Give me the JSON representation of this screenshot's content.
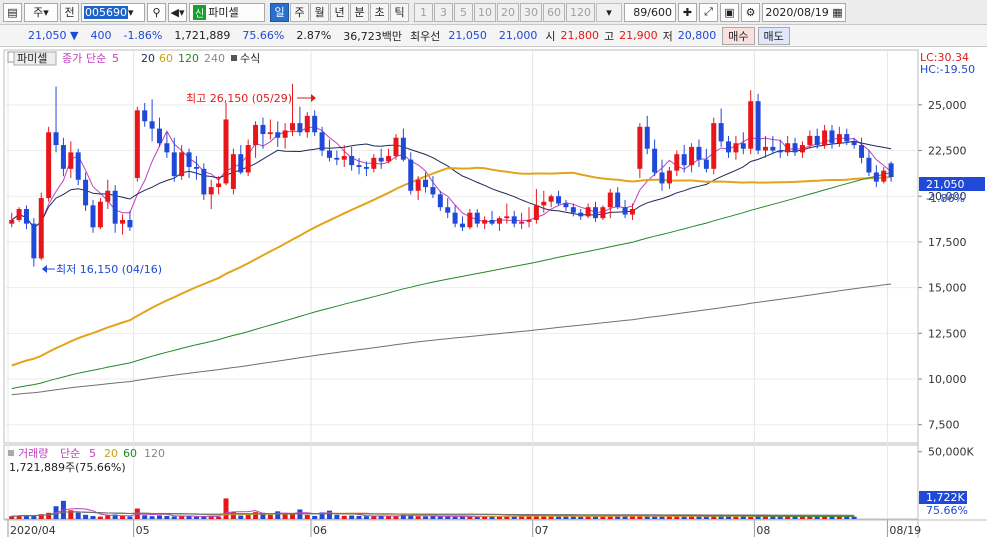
{
  "toolbar": {
    "period_btn": "주",
    "prev_btn": "전",
    "stock_code": "005690",
    "credit_badge": "신",
    "stock_name": "파미셀",
    "periods": [
      "일",
      "주",
      "월",
      "년",
      "분",
      "초",
      "틱"
    ],
    "active_period": "일",
    "intervals": [
      "1",
      "3",
      "5",
      "10",
      "20",
      "30",
      "60",
      "120"
    ],
    "count": "89/600",
    "date": "2020/08/19"
  },
  "quote": {
    "price": "21,050",
    "change": "400",
    "change_pct": "-1.86%",
    "volume": "1,721,889",
    "vol_ratio": "75.66%",
    "turnover": "2.87%",
    "amount": "36,723백만",
    "bid_label": "최우선",
    "bid": "21,050",
    "ask": "21,000",
    "open_label": "시",
    "open": "21,800",
    "high_label": "고",
    "high": "21,900",
    "low_label": "저",
    "low": "20,800",
    "buy_btn": "매수",
    "sell_btn": "매도"
  },
  "price_panel": {
    "name_tag": "파미셀",
    "legend_close": "종가",
    "legend_method": "단순",
    "ma_periods": [
      "5",
      "20",
      "60",
      "120",
      "240"
    ],
    "formula": "수식",
    "lc_label": "LC:30.34",
    "hc_label": "HC:-19.50",
    "high_annotation": "최고 26,150 (05/29)",
    "low_annotation": "최저 16,150 (04/16)",
    "last_price_tag": "21,050",
    "last_pct_tag": "-1.86%"
  },
  "volume_panel": {
    "title": "거래량",
    "method": "단순",
    "ma_periods": [
      "5",
      "20",
      "60",
      "120"
    ],
    "info": "1,721,889주(75.66%)",
    "last_tag": "1,722K",
    "pct_tag": "75.66%"
  },
  "colors": {
    "up": "#e8161b",
    "down": "#1f49d6",
    "ma5": "#c040c0",
    "ma20": "#1c2a5a",
    "ma60": "#e3a41c",
    "ma120": "#24882a",
    "ma240": "#707070"
  },
  "chart_data": {
    "type": "candlestick",
    "y_ticks": [
      7500,
      10000,
      12500,
      15000,
      17500,
      20000,
      22500,
      25000
    ],
    "y_tick_labels": [
      "7,500",
      "10,000",
      "12,500",
      "15,000",
      "17,500",
      "20,000",
      "22,500",
      "25,000"
    ],
    "ylim": [
      6500,
      28000
    ],
    "volume_tick_labels": [
      "50,000K"
    ],
    "volume_ylim": [
      0,
      55000
    ],
    "x_labels": [
      "2020/04",
      "05",
      "06",
      "07",
      "08",
      "08/19"
    ],
    "x_label_index": [
      0,
      17,
      41,
      71,
      101,
      119
    ],
    "candles": [
      [
        18500,
        19100,
        18300,
        18700
      ],
      [
        18700,
        19400,
        18600,
        19300
      ],
      [
        19300,
        19500,
        18200,
        18500
      ],
      [
        18500,
        18800,
        16150,
        16600
      ],
      [
        16600,
        20200,
        16500,
        19900
      ],
      [
        19900,
        23800,
        19700,
        23500
      ],
      [
        23500,
        26000,
        22400,
        22800
      ],
      [
        22800,
        23200,
        21100,
        21500
      ],
      [
        21500,
        23000,
        21000,
        22400
      ],
      [
        22400,
        22600,
        20600,
        20900
      ],
      [
        20900,
        21300,
        19200,
        19500
      ],
      [
        19500,
        19800,
        18000,
        18300
      ],
      [
        18300,
        19900,
        18200,
        19700
      ],
      [
        19700,
        20900,
        19300,
        20300
      ],
      [
        20300,
        20600,
        18000,
        18500
      ],
      [
        18500,
        19000,
        17900,
        18700
      ],
      [
        18700,
        19200,
        18100,
        18300
      ],
      [
        21000,
        24900,
        20800,
        24700
      ],
      [
        24700,
        25100,
        23800,
        24100
      ],
      [
        24100,
        25300,
        23000,
        23700
      ],
      [
        23700,
        24300,
        22700,
        22900
      ],
      [
        22900,
        23500,
        22100,
        22400
      ],
      [
        22400,
        23200,
        20800,
        21100
      ],
      [
        21100,
        22800,
        20900,
        22400
      ],
      [
        22400,
        22600,
        21000,
        21600
      ],
      [
        21600,
        22200,
        20900,
        21500
      ],
      [
        21500,
        21800,
        19800,
        20100
      ],
      [
        20100,
        20900,
        19300,
        20500
      ],
      [
        20500,
        21100,
        20100,
        20700
      ],
      [
        20700,
        25100,
        20600,
        24200
      ],
      [
        20400,
        22600,
        20100,
        22300
      ],
      [
        22300,
        22800,
        21200,
        21300
      ],
      [
        21300,
        23100,
        21100,
        22800
      ],
      [
        22800,
        24100,
        22100,
        23900
      ],
      [
        23900,
        24300,
        22600,
        23400
      ],
      [
        23400,
        24200,
        23100,
        23500
      ],
      [
        23500,
        24100,
        22700,
        23200
      ],
      [
        23200,
        24000,
        22600,
        23600
      ],
      [
        23600,
        26150,
        23300,
        24000
      ],
      [
        24000,
        24900,
        23300,
        23500
      ],
      [
        23500,
        24600,
        23200,
        24400
      ],
      [
        24400,
        24700,
        23300,
        23500
      ],
      [
        23500,
        23800,
        22200,
        22500
      ],
      [
        22500,
        23100,
        21900,
        22100
      ],
      [
        22100,
        22500,
        21700,
        22000
      ],
      [
        22000,
        22800,
        21600,
        22200
      ],
      [
        22200,
        22700,
        21400,
        21700
      ],
      [
        21700,
        22100,
        21200,
        21600
      ],
      [
        21600,
        21900,
        21100,
        21500
      ],
      [
        21500,
        22300,
        21300,
        22100
      ],
      [
        22100,
        22600,
        21500,
        21900
      ],
      [
        21900,
        22600,
        21800,
        22200
      ],
      [
        22200,
        23400,
        22000,
        23200
      ],
      [
        23200,
        23700,
        21900,
        22000
      ],
      [
        22000,
        22400,
        20100,
        20300
      ],
      [
        20300,
        21100,
        19800,
        20900
      ],
      [
        20900,
        21300,
        20200,
        20500
      ],
      [
        20500,
        21100,
        19900,
        20100
      ],
      [
        20100,
        20300,
        19200,
        19400
      ],
      [
        19400,
        19900,
        18800,
        19100
      ],
      [
        19100,
        19500,
        18300,
        18500
      ],
      [
        18500,
        18900,
        18100,
        18300
      ],
      [
        18300,
        19300,
        18200,
        19100
      ],
      [
        19100,
        19300,
        18300,
        18500
      ],
      [
        18500,
        18900,
        18200,
        18700
      ],
      [
        18700,
        19200,
        18400,
        18500
      ],
      [
        18500,
        18900,
        18100,
        18800
      ],
      [
        18800,
        19600,
        18500,
        18900
      ],
      [
        18900,
        19200,
        18300,
        18500
      ],
      [
        18500,
        19100,
        18200,
        18600
      ],
      [
        18600,
        19400,
        18300,
        18700
      ],
      [
        18700,
        20400,
        18500,
        19500
      ],
      [
        19500,
        20300,
        19100,
        19700
      ],
      [
        19700,
        20100,
        19400,
        20000
      ],
      [
        20000,
        20300,
        19500,
        19600
      ],
      [
        19600,
        19800,
        19200,
        19400
      ],
      [
        19400,
        19600,
        18900,
        19100
      ],
      [
        19100,
        19300,
        18700,
        18900
      ],
      [
        18900,
        19600,
        18800,
        19400
      ],
      [
        19400,
        19700,
        18600,
        18800
      ],
      [
        18800,
        19500,
        18700,
        19400
      ],
      [
        19400,
        20400,
        18800,
        20200
      ],
      [
        20200,
        20500,
        19300,
        19400
      ],
      [
        19400,
        19800,
        18800,
        19000
      ],
      [
        19000,
        19600,
        18700,
        19300
      ],
      [
        21500,
        24000,
        21000,
        23800
      ],
      [
        23800,
        24400,
        22300,
        22600
      ],
      [
        22600,
        23100,
        21100,
        21300
      ],
      [
        21300,
        22000,
        20300,
        20700
      ],
      [
        20700,
        21600,
        20400,
        21400
      ],
      [
        21400,
        22500,
        21100,
        22300
      ],
      [
        22300,
        22800,
        21300,
        21700
      ],
      [
        21700,
        22900,
        21300,
        22700
      ],
      [
        22700,
        23100,
        21600,
        22000
      ],
      [
        22000,
        22600,
        21300,
        21500
      ],
      [
        21500,
        24300,
        21200,
        24000
      ],
      [
        24000,
        24800,
        22700,
        23000
      ],
      [
        23000,
        23300,
        22100,
        22400
      ],
      [
        22400,
        23300,
        22000,
        22900
      ],
      [
        22900,
        23500,
        22300,
        22600
      ],
      [
        22600,
        25800,
        22300,
        25200
      ],
      [
        25200,
        25600,
        22300,
        22500
      ],
      [
        22500,
        23300,
        22100,
        22700
      ],
      [
        22700,
        23300,
        22300,
        22500
      ],
      [
        22500,
        23100,
        22100,
        22400
      ],
      [
        22400,
        23300,
        22200,
        22900
      ],
      [
        22900,
        23200,
        22200,
        22400
      ],
      [
        22400,
        23000,
        22100,
        22800
      ],
      [
        22800,
        23600,
        22600,
        23300
      ],
      [
        23300,
        23700,
        22600,
        22800
      ],
      [
        22800,
        23900,
        22600,
        23600
      ],
      [
        23600,
        23900,
        22600,
        22900
      ],
      [
        22900,
        23800,
        22700,
        23400
      ],
      [
        23400,
        23700,
        22800,
        23000
      ],
      [
        23000,
        23200,
        22600,
        22800
      ],
      [
        22800,
        23200,
        21800,
        22100
      ],
      [
        22100,
        22500,
        21100,
        21300
      ],
      [
        21300,
        21700,
        20500,
        20800
      ],
      [
        20800,
        21600,
        20700,
        21400
      ],
      [
        21800,
        21900,
        20800,
        21050
      ]
    ],
    "volume_k": [
      2100,
      2500,
      3000,
      2400,
      3600,
      4600,
      9500,
      13500,
      6500,
      4700,
      3100,
      2200,
      1800,
      2700,
      3300,
      2300,
      1900,
      7800,
      2800,
      2100,
      2700,
      2300,
      1900,
      2100,
      2000,
      1700,
      2100,
      1900,
      1600,
      15300,
      5300,
      2500,
      2900,
      5100,
      4600,
      3100,
      5700,
      3400,
      4100,
      7100,
      3000,
      2300,
      4900,
      6200,
      3100,
      2400,
      2600,
      2300,
      2100,
      1900,
      2500,
      2200,
      2600,
      3200,
      2400,
      2000,
      1900,
      2200,
      1800,
      2100,
      1600,
      2000,
      1700,
      2200,
      1700,
      1900,
      2000,
      2200,
      1900,
      2300,
      2600,
      2600,
      2800,
      1900,
      2300,
      1800,
      2100,
      1600,
      1900,
      2200,
      1800,
      2300,
      2600,
      2000,
      2000,
      2400,
      1900,
      1800,
      1900,
      2300,
      2000,
      1800,
      2100,
      1900,
      1700,
      2300,
      3400,
      2000,
      1700,
      2500,
      1500,
      2300,
      1900,
      2400,
      1600,
      1900,
      2200,
      2400,
      1900,
      2100,
      1800,
      2000,
      2200,
      1700,
      1700
    ]
  }
}
